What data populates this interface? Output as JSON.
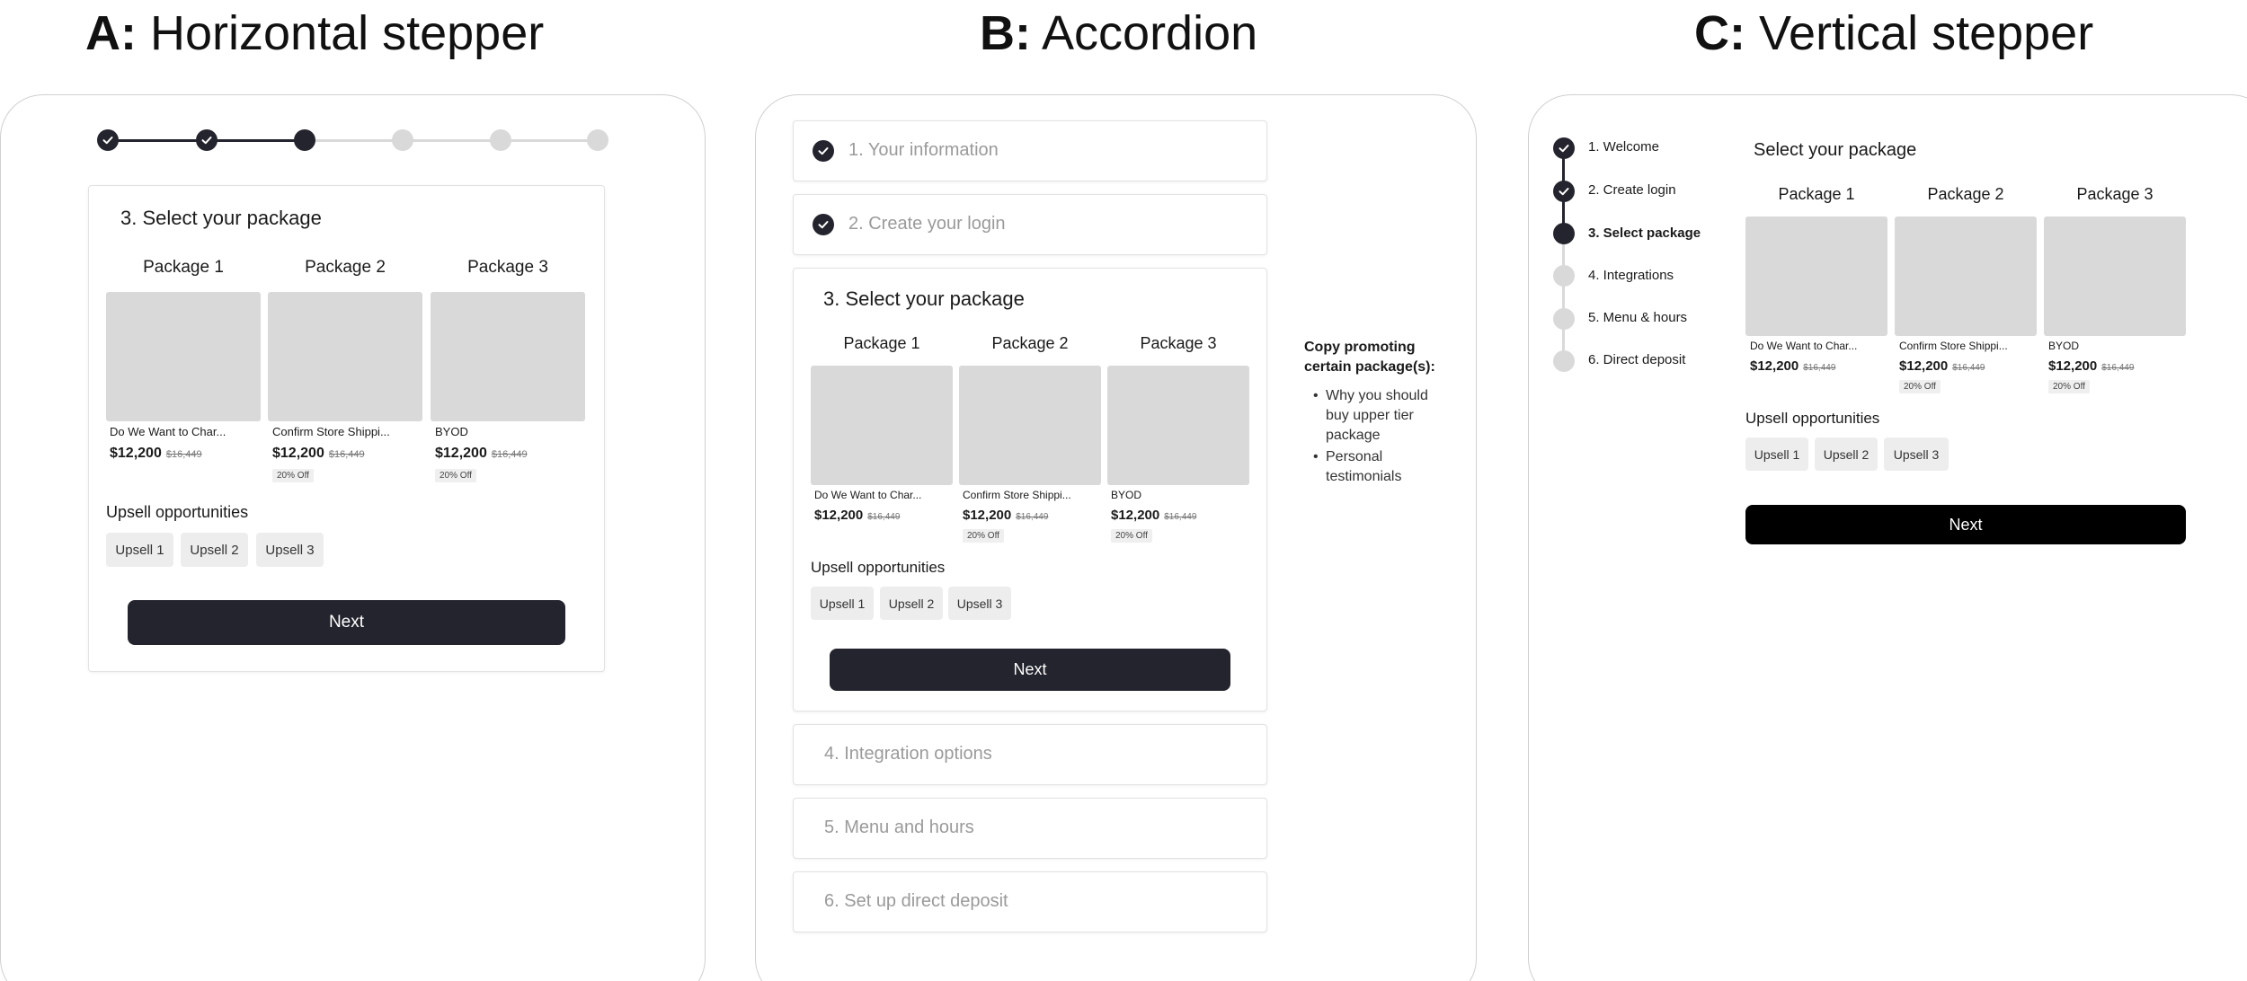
{
  "sections": {
    "a": {
      "letter": "A:",
      "title": "Horizontal stepper"
    },
    "b": {
      "letter": "B:",
      "title": "Accordion"
    },
    "c": {
      "letter": "C:",
      "title": "Vertical stepper"
    }
  },
  "horizontal": {
    "step_title": "3. Select your package",
    "steps_completed": 2,
    "current_step": 3,
    "total_steps": 6
  },
  "accordion": {
    "items": [
      {
        "label": "1. Your information",
        "state": "completed"
      },
      {
        "label": "2. Create your login",
        "state": "completed"
      },
      {
        "label": "3. Select your package",
        "state": "expanded"
      },
      {
        "label": "4. Integration options",
        "state": "collapsed"
      },
      {
        "label": "5. Menu and hours",
        "state": "collapsed"
      },
      {
        "label": "6. Set up direct deposit",
        "state": "collapsed"
      }
    ],
    "copy_note": {
      "title": "Copy promoting certain package(s):",
      "bullets": [
        "Why you should buy upper tier package",
        "Personal testimonials"
      ]
    }
  },
  "vertical": {
    "step_title": "Select your package",
    "steps": [
      {
        "label": "1. Welcome",
        "state": "completed"
      },
      {
        "label": "2. Create login",
        "state": "completed"
      },
      {
        "label": "3. Select package",
        "state": "current"
      },
      {
        "label": "4. Integrations",
        "state": "upcoming"
      },
      {
        "label": "5. Menu & hours",
        "state": "upcoming"
      },
      {
        "label": "6. Direct deposit",
        "state": "upcoming"
      }
    ]
  },
  "packages": [
    {
      "label": "Package 1",
      "name": "Do We Want to Char...",
      "price": "$12,200",
      "original_price": "$16,449",
      "badge": ""
    },
    {
      "label": "Package 2",
      "name": "Confirm Store Shippi...",
      "price": "$12,200",
      "original_price": "$16,449",
      "badge": "20% Off"
    },
    {
      "label": "Package 3",
      "name": "BYOD",
      "price": "$12,200",
      "original_price": "$16,449",
      "badge": "20% Off"
    }
  ],
  "upsell": {
    "heading": "Upsell opportunities",
    "chips": [
      "Upsell 1",
      "Upsell 2",
      "Upsell 3"
    ]
  },
  "next_label": "Next",
  "colors": {
    "dark": "#24242e",
    "inactive": "#d9d9d9",
    "placeholder": "#d9d9d9",
    "black": "#000000"
  }
}
